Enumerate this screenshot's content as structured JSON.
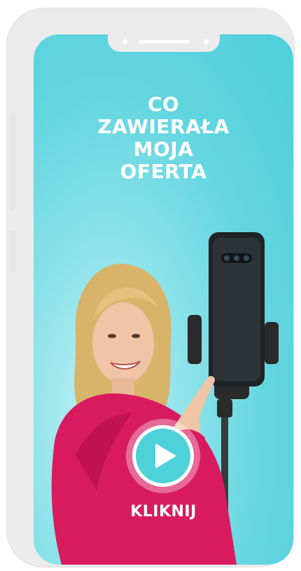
{
  "headline": {
    "line1": "CO",
    "line2": "ZAWIERAŁA",
    "line3": "MOJA",
    "line4": "OFERTA"
  },
  "video": {
    "play_icon": "play-icon",
    "cta_label": "KLIKNIJ"
  },
  "colors": {
    "screen_bg": "#5ad3dd",
    "play_button": "#4fd1d9",
    "frame": "#ebebeb",
    "blouse": "#d81b5f"
  }
}
